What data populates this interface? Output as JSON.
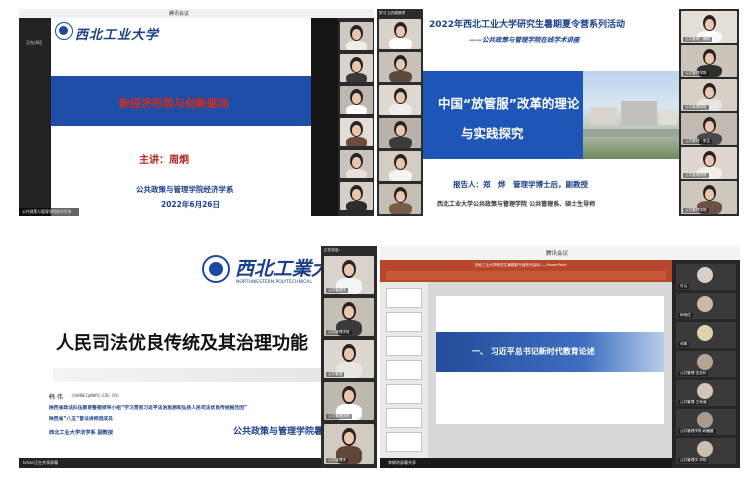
{
  "p1": {
    "window_title": "腾讯会议",
    "logo_text": "西北工业大学",
    "slide_title": "新经济形势与创新驱动",
    "lecturer": "主讲：周炯",
    "department": "公共政策与管理学院经济学系",
    "date": "2022年6月26日",
    "left_status": "正在讲话",
    "bottom_name": "公共政策与管理学院经济学系"
  },
  "p2": {
    "top_label": "学习 公共政策学",
    "title": "2022年西北工业大学研究生暑期夏令营系列活动",
    "subtitle": "——公共政策与管理学院在线学术讲座",
    "main_title_1": "中国“放管服”改革的理论",
    "main_title_2": "与实践探究",
    "speaker": "报告人：郑　烨　管理学博士后，副教授",
    "affiliation": "西北工业大学公共政策与管理学院  公共管理系、硕士生导师",
    "right_labels": [
      "公共管理 · 博硕",
      "公共管理学院",
      "公共管理学院",
      "公共管理 · 学生",
      "公共管理学院",
      "公共管理学院"
    ]
  },
  "p3": {
    "logo_cn": "西北工業大",
    "logo_en": "NORTHWESTERN POLYTECHNICAL",
    "main_title": "人民司法优良传统及其治理功能",
    "author_name": "韩 伟",
    "email": "(HANWEI@NWPU.EDU.CN)",
    "line1": "陕西省政法队伍教育整顿领导小组“学习贯彻习近平法治思想和弘扬人民司法优良传统报告团”",
    "line2": "陕西省“八五”普法讲师团成员",
    "line3": "西北工业大学法学系  副教授",
    "footer_dept": "公共政策与管理学院暑",
    "bottom_status": "Ivhan正在共享屏幕",
    "right_top_label": "正在讲话：",
    "right_labels": [
      "公共管理学",
      "公共管理学院",
      "公共管理",
      "公共管理学院",
      "公共管理学"
    ]
  },
  "p4": {
    "window_title": "腾讯会议",
    "ppt_title": "西北工业大学研究生暑期夏令营系列活动——PowerPoint",
    "section_title": "一、  习近平总书记新时代教育论述",
    "share_label": "李辉的屏幕共享",
    "participants": [
      "可以",
      "和倪佳",
      "司琴",
      "公共管理·张亚玲",
      "公共管理-王雨涵",
      "公共管理学院-韩媛媛",
      "公共管理学-学院"
    ]
  },
  "colors": {
    "blue_band": "#1e4ea8",
    "red_title": "#d42c1b",
    "nwpu_blue": "#1b4aa0",
    "dark_bg": "#1f1f1f",
    "section_bar": "#234c9a"
  }
}
